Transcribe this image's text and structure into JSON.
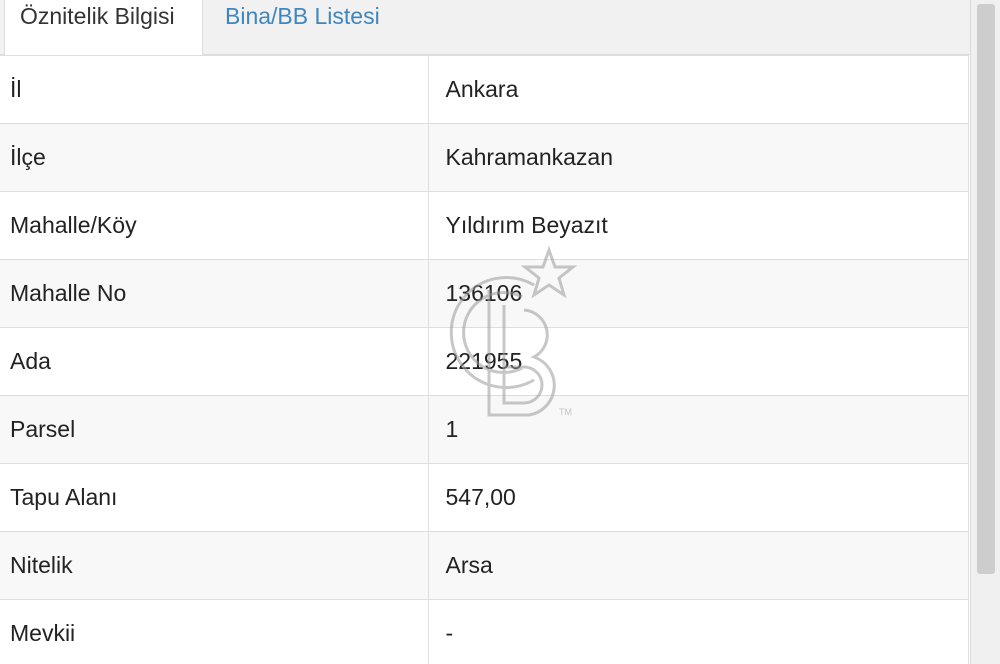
{
  "tabs": [
    {
      "label": "Öznitelik Bilgisi",
      "active": true
    },
    {
      "label": "Bina/BB Listesi",
      "active": false
    }
  ],
  "attributes": [
    {
      "label": "İl",
      "value": "Ankara"
    },
    {
      "label": "İlçe",
      "value": "Kahramankazan"
    },
    {
      "label": "Mahalle/Köy",
      "value": "Yıldırım Beyazıt"
    },
    {
      "label": "Mahalle No",
      "value": "136106"
    },
    {
      "label": "Ada",
      "value": "221955"
    },
    {
      "label": "Parsel",
      "value": "1"
    },
    {
      "label": "Tapu Alanı",
      "value": "547,00"
    },
    {
      "label": "Nitelik",
      "value": "Arsa"
    },
    {
      "label": "Mevkii",
      "value": "-"
    }
  ],
  "watermark": {
    "icon": "cb-logo-icon",
    "text": "TM"
  },
  "colors": {
    "tab_link": "#3f86c0",
    "row_alt": "#f8f8f8",
    "border": "#dedede"
  }
}
